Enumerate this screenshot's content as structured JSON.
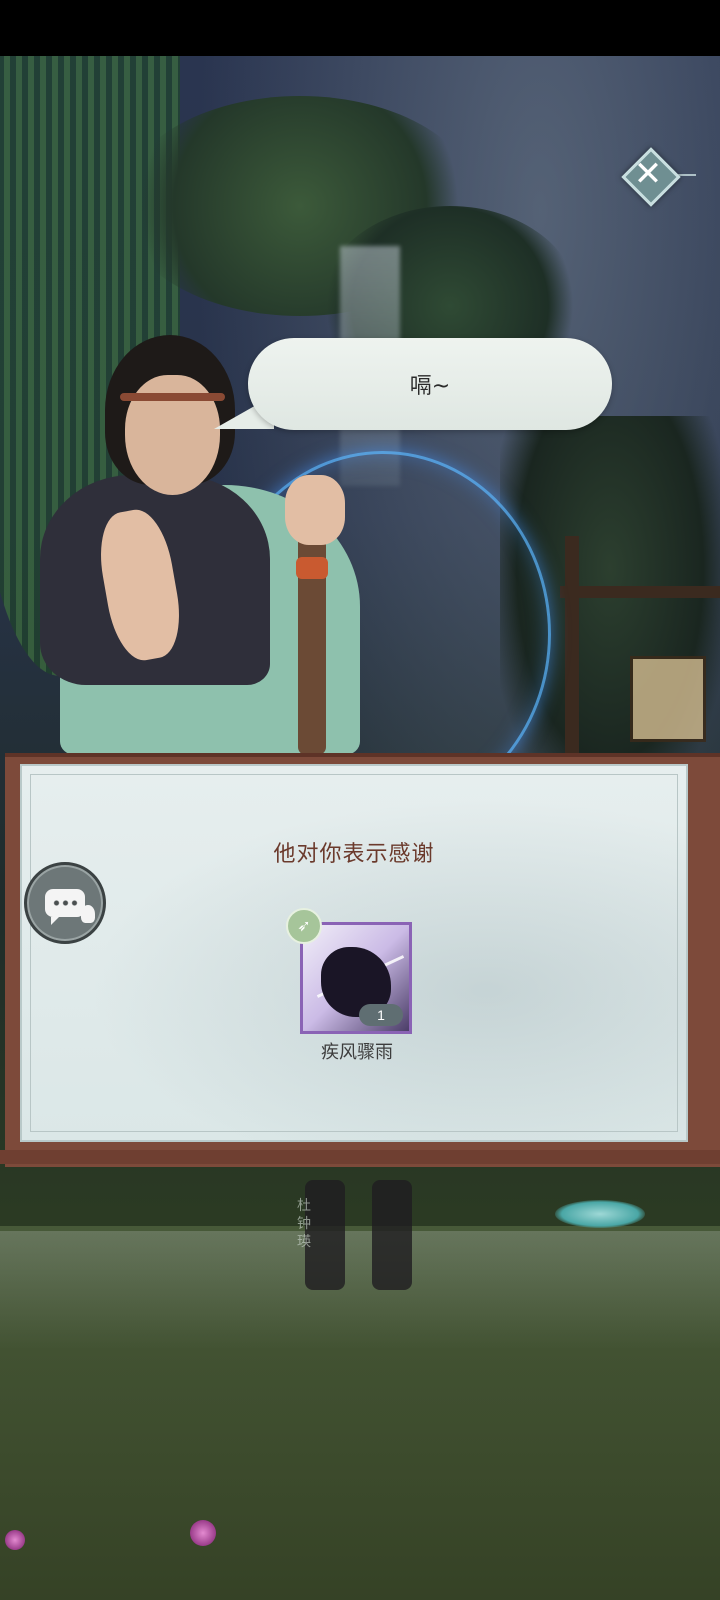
{
  "speech_bubble": {
    "text": "嗝~"
  },
  "reward_panel": {
    "title": "他对你表示感谢",
    "item": {
      "name": "疾风骤雨",
      "count": "1",
      "rarity_color": "#8a63b5"
    }
  },
  "scene": {
    "name_tag": "杜钟瑛"
  },
  "icons": {
    "close": "close-icon",
    "chat": "chat-icon",
    "item_type": "arrow-icon"
  }
}
